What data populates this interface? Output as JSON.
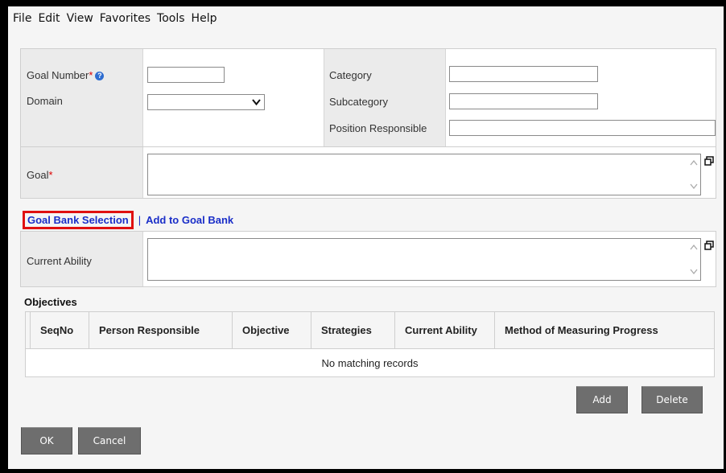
{
  "menu": [
    "File",
    "Edit",
    "View",
    "Favorites",
    "Tools",
    "Help"
  ],
  "form": {
    "goal_number_label": "Goal Number",
    "domain_label": "Domain",
    "category_label": "Category",
    "subcategory_label": "Subcategory",
    "position_label": "Position Responsible",
    "goal_label": "Goal",
    "required_mark": "*",
    "current_ability_label": "Current Ability",
    "goal_number_value": "",
    "domain_value": "",
    "category_value": "",
    "subcategory_value": "",
    "position_value": ""
  },
  "links": {
    "goal_bank_selection": "Goal Bank Selection",
    "separator": "|",
    "add_to_goal_bank": "Add to Goal Bank"
  },
  "objectives": {
    "title": "Objectives",
    "columns": [
      "SeqNo",
      "Person Responsible",
      "Objective",
      "Strategies",
      "Current Ability",
      "Method of Measuring Progress"
    ],
    "empty_text": "No matching records"
  },
  "buttons": {
    "add": "Add",
    "delete": "Delete",
    "ok": "OK",
    "cancel": "Cancel"
  },
  "colors": {
    "link": "#1a2ec8",
    "highlight": "#e01010",
    "button": "#6e6e6e",
    "required": "#d00000"
  }
}
